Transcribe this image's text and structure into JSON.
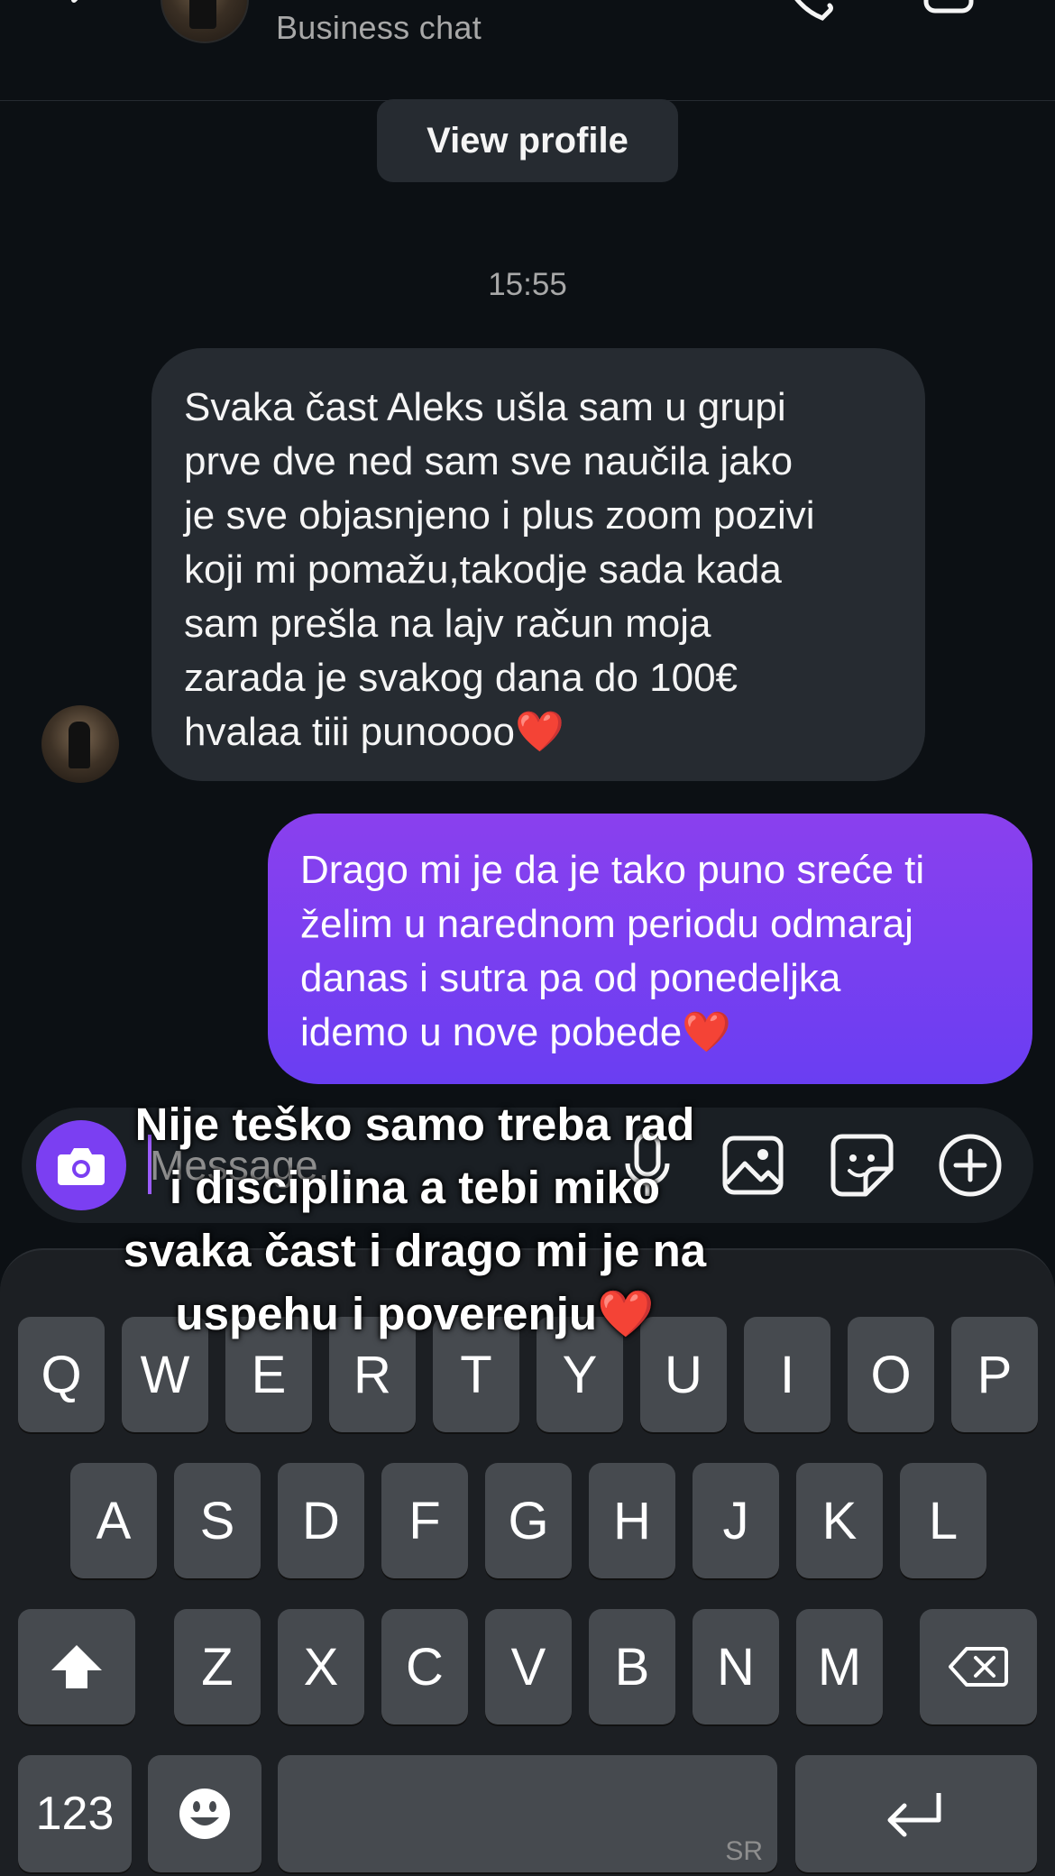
{
  "header": {
    "subtitle": "Business chat"
  },
  "profile": {
    "view_profile_label": "View profile"
  },
  "chat": {
    "timestamp": "15:55",
    "incoming_message": "Svaka čast Aleks ušla sam u grupi\nprve dve ned sam sve naučila jako\nje sve objasnjeno i plus zoom pozivi\nkoji mi pomažu,takodje sada kada\nsam prešla na lajv račun moja\nzarada je svakog dana do 100€\nhvalaa tiii punoooo❤️",
    "outgoing_message": "Drago mi je da je tako puno sreće ti\nželim u narednom periodu odmaraj\ndanas i sutra pa od ponedeljka\nidemo u nove pobede❤️"
  },
  "composer": {
    "placeholder": "Message..."
  },
  "overlay_caption": "Nije teško samo treba rad\ni disciplina a tebi miko\nsvaka čast i drago mi je na\nuspehu i poverenju❤️",
  "keyboard": {
    "row1": [
      "Q",
      "W",
      "E",
      "R",
      "T",
      "Y",
      "U",
      "I",
      "O",
      "P"
    ],
    "row2": [
      "A",
      "S",
      "D",
      "F",
      "G",
      "H",
      "J",
      "K",
      "L"
    ],
    "row3": [
      "Z",
      "X",
      "C",
      "V",
      "B",
      "N",
      "M"
    ],
    "numbers_label": "123",
    "space_language": "SR"
  },
  "colors": {
    "background": "#0c1014",
    "incoming_bubble": "#262b31",
    "outgoing_bubble_top": "#8a40ee",
    "outgoing_bubble_bottom": "#6a3ef2",
    "accent": "#7b3ff2",
    "key": "#464a4f"
  },
  "icons": [
    "back-arrow-icon",
    "phone-icon",
    "video-camera-icon",
    "camera-icon",
    "microphone-icon",
    "gallery-icon",
    "sticker-icon",
    "plus-circle-icon",
    "shift-icon",
    "backspace-icon",
    "emoji-icon",
    "return-icon"
  ]
}
